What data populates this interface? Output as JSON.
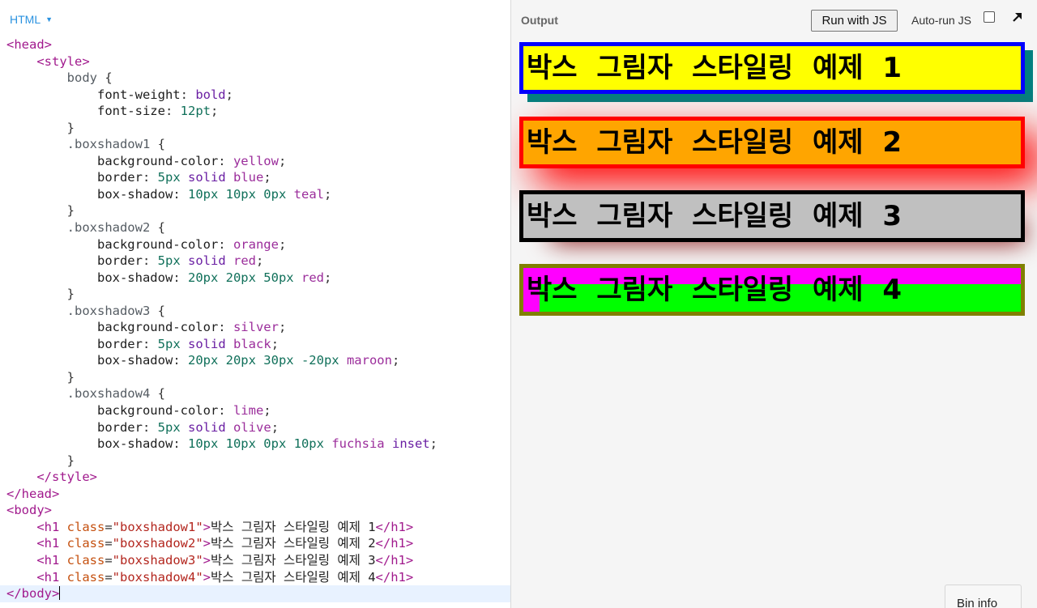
{
  "editor": {
    "language": "HTML",
    "lines": [
      [
        [
          "t-tag",
          "<head>"
        ]
      ],
      [
        [
          "t-txt",
          "    "
        ],
        [
          "t-tag",
          "<style>"
        ]
      ],
      [
        [
          "t-txt",
          "        "
        ],
        [
          "t-sel",
          "body"
        ],
        [
          "t-pun",
          " {"
        ]
      ],
      [
        [
          "t-txt",
          "            "
        ],
        [
          "t-prop",
          "font-weight"
        ],
        [
          "t-pun",
          ": "
        ],
        [
          "t-kw",
          "bold"
        ],
        [
          "t-pun",
          ";"
        ]
      ],
      [
        [
          "t-txt",
          "            "
        ],
        [
          "t-prop",
          "font-size"
        ],
        [
          "t-pun",
          ": "
        ],
        [
          "t-num",
          "12pt"
        ],
        [
          "t-pun",
          ";"
        ]
      ],
      [
        [
          "t-txt",
          "        "
        ],
        [
          "t-pun",
          "}"
        ]
      ],
      [
        [
          "t-txt",
          "        "
        ],
        [
          "t-sel",
          ".boxshadow1"
        ],
        [
          "t-pun",
          " {"
        ]
      ],
      [
        [
          "t-txt",
          "            "
        ],
        [
          "t-prop",
          "background-color"
        ],
        [
          "t-pun",
          ": "
        ],
        [
          "t-col",
          "yellow"
        ],
        [
          "t-pun",
          ";"
        ]
      ],
      [
        [
          "t-txt",
          "            "
        ],
        [
          "t-prop",
          "border"
        ],
        [
          "t-pun",
          ": "
        ],
        [
          "t-num",
          "5px"
        ],
        [
          "t-pun",
          " "
        ],
        [
          "t-kw",
          "solid"
        ],
        [
          "t-pun",
          " "
        ],
        [
          "t-col",
          "blue"
        ],
        [
          "t-pun",
          ";"
        ]
      ],
      [
        [
          "t-txt",
          "            "
        ],
        [
          "t-prop",
          "box-shadow"
        ],
        [
          "t-pun",
          ": "
        ],
        [
          "t-num",
          "10px 10px 0px"
        ],
        [
          "t-pun",
          " "
        ],
        [
          "t-col",
          "teal"
        ],
        [
          "t-pun",
          ";"
        ]
      ],
      [
        [
          "t-txt",
          "        "
        ],
        [
          "t-pun",
          "}"
        ]
      ],
      [
        [
          "t-txt",
          "        "
        ],
        [
          "t-sel",
          ".boxshadow2"
        ],
        [
          "t-pun",
          " {"
        ]
      ],
      [
        [
          "t-txt",
          "            "
        ],
        [
          "t-prop",
          "background-color"
        ],
        [
          "t-pun",
          ": "
        ],
        [
          "t-col",
          "orange"
        ],
        [
          "t-pun",
          ";"
        ]
      ],
      [
        [
          "t-txt",
          "            "
        ],
        [
          "t-prop",
          "border"
        ],
        [
          "t-pun",
          ": "
        ],
        [
          "t-num",
          "5px"
        ],
        [
          "t-pun",
          " "
        ],
        [
          "t-kw",
          "solid"
        ],
        [
          "t-pun",
          " "
        ],
        [
          "t-col",
          "red"
        ],
        [
          "t-pun",
          ";"
        ]
      ],
      [
        [
          "t-txt",
          "            "
        ],
        [
          "t-prop",
          "box-shadow"
        ],
        [
          "t-pun",
          ": "
        ],
        [
          "t-num",
          "20px 20px 50px"
        ],
        [
          "t-pun",
          " "
        ],
        [
          "t-col",
          "red"
        ],
        [
          "t-pun",
          ";"
        ]
      ],
      [
        [
          "t-txt",
          "        "
        ],
        [
          "t-pun",
          "}"
        ]
      ],
      [
        [
          "t-txt",
          "        "
        ],
        [
          "t-sel",
          ".boxshadow3"
        ],
        [
          "t-pun",
          " {"
        ]
      ],
      [
        [
          "t-txt",
          "            "
        ],
        [
          "t-prop",
          "background-color"
        ],
        [
          "t-pun",
          ": "
        ],
        [
          "t-col",
          "silver"
        ],
        [
          "t-pun",
          ";"
        ]
      ],
      [
        [
          "t-txt",
          "            "
        ],
        [
          "t-prop",
          "border"
        ],
        [
          "t-pun",
          ": "
        ],
        [
          "t-num",
          "5px"
        ],
        [
          "t-pun",
          " "
        ],
        [
          "t-kw",
          "solid"
        ],
        [
          "t-pun",
          " "
        ],
        [
          "t-col",
          "black"
        ],
        [
          "t-pun",
          ";"
        ]
      ],
      [
        [
          "t-txt",
          "            "
        ],
        [
          "t-prop",
          "box-shadow"
        ],
        [
          "t-pun",
          ": "
        ],
        [
          "t-num",
          "20px 20px 30px -20px"
        ],
        [
          "t-pun",
          " "
        ],
        [
          "t-col",
          "maroon"
        ],
        [
          "t-pun",
          ";"
        ]
      ],
      [
        [
          "t-txt",
          "        "
        ],
        [
          "t-pun",
          "}"
        ]
      ],
      [
        [
          "t-txt",
          "        "
        ],
        [
          "t-sel",
          ".boxshadow4"
        ],
        [
          "t-pun",
          " {"
        ]
      ],
      [
        [
          "t-txt",
          "            "
        ],
        [
          "t-prop",
          "background-color"
        ],
        [
          "t-pun",
          ": "
        ],
        [
          "t-col",
          "lime"
        ],
        [
          "t-pun",
          ";"
        ]
      ],
      [
        [
          "t-txt",
          "            "
        ],
        [
          "t-prop",
          "border"
        ],
        [
          "t-pun",
          ": "
        ],
        [
          "t-num",
          "5px"
        ],
        [
          "t-pun",
          " "
        ],
        [
          "t-kw",
          "solid"
        ],
        [
          "t-pun",
          " "
        ],
        [
          "t-col",
          "olive"
        ],
        [
          "t-pun",
          ";"
        ]
      ],
      [
        [
          "t-txt",
          "            "
        ],
        [
          "t-prop",
          "box-shadow"
        ],
        [
          "t-pun",
          ": "
        ],
        [
          "t-num",
          "10px 10px 0px 10px"
        ],
        [
          "t-pun",
          " "
        ],
        [
          "t-col",
          "fuchsia"
        ],
        [
          "t-pun",
          " "
        ],
        [
          "t-kw",
          "inset"
        ],
        [
          "t-pun",
          ";"
        ]
      ],
      [
        [
          "t-txt",
          "        "
        ],
        [
          "t-pun",
          "}"
        ]
      ],
      [
        [
          "t-txt",
          "    "
        ],
        [
          "t-tag",
          "</style>"
        ]
      ],
      [
        [
          "t-tag",
          "</head>"
        ]
      ],
      [
        [
          "t-tag",
          "<body>"
        ]
      ],
      [
        [
          "t-txt",
          "    "
        ],
        [
          "t-tag",
          "<h1 "
        ],
        [
          "t-attr",
          "class"
        ],
        [
          "t-pun",
          "="
        ],
        [
          "t-str",
          "\"boxshadow1\""
        ],
        [
          "t-tag",
          ">"
        ],
        [
          "t-txt",
          "박스 그림자 스타일링 예제 1"
        ],
        [
          "t-tag",
          "</h1>"
        ]
      ],
      [
        [
          "t-txt",
          "    "
        ],
        [
          "t-tag",
          "<h1 "
        ],
        [
          "t-attr",
          "class"
        ],
        [
          "t-pun",
          "="
        ],
        [
          "t-str",
          "\"boxshadow2\""
        ],
        [
          "t-tag",
          ">"
        ],
        [
          "t-txt",
          "박스 그림자 스타일링 예제 2"
        ],
        [
          "t-tag",
          "</h1>"
        ]
      ],
      [
        [
          "t-txt",
          "    "
        ],
        [
          "t-tag",
          "<h1 "
        ],
        [
          "t-attr",
          "class"
        ],
        [
          "t-pun",
          "="
        ],
        [
          "t-str",
          "\"boxshadow3\""
        ],
        [
          "t-tag",
          ">"
        ],
        [
          "t-txt",
          "박스 그림자 스타일링 예제 3"
        ],
        [
          "t-tag",
          "</h1>"
        ]
      ],
      [
        [
          "t-txt",
          "    "
        ],
        [
          "t-tag",
          "<h1 "
        ],
        [
          "t-attr",
          "class"
        ],
        [
          "t-pun",
          "="
        ],
        [
          "t-str",
          "\"boxshadow4\""
        ],
        [
          "t-tag",
          ">"
        ],
        [
          "t-txt",
          "박스 그림자 스타일링 예제 4"
        ],
        [
          "t-tag",
          "</h1>"
        ]
      ],
      [
        [
          "t-tag",
          "</body>"
        ]
      ]
    ]
  },
  "output": {
    "title": "Output",
    "run_label": "Run with JS",
    "autorun_label": "Auto-run JS",
    "autorun_checked": false,
    "expand_icon": "arrow-up-right-icon",
    "headings": [
      "박스 그림자 스타일링 예제 1",
      "박스 그림자 스타일링 예제 2",
      "박스 그림자 스타일링 예제 3",
      "박스 그림자 스타일링 예제 4"
    ],
    "bin_info_label": "Bin info"
  },
  "colors": {
    "accent": "#2a92e0",
    "output_bg": "#f5f5f5"
  }
}
